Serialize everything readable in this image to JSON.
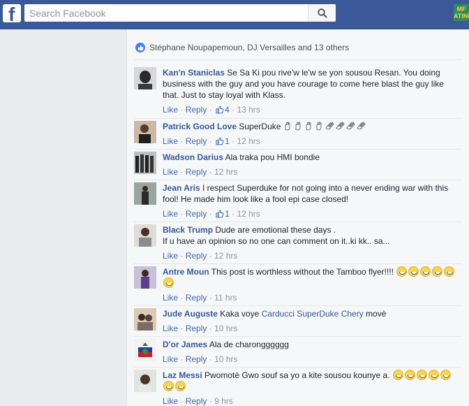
{
  "search": {
    "placeholder": "Search Facebook"
  },
  "app_badge": "MF ATINF",
  "reactions": {
    "text": "Stéphane Noupapemoun, DJ Versailles and 13 others"
  },
  "actions": {
    "like": "Like",
    "reply": "Reply",
    "dot": "·"
  },
  "comments": [
    {
      "author": "Kan'n Staniclas",
      "text": "Se Sa Ki pou rive'w le'w se yon sousou Resan. You doing business with the guy and you have courage to come here blast the guy like that. Just to stay loyal with Klass.",
      "likes": "4",
      "time": "13 hrs"
    },
    {
      "author": "Patrick Good Love",
      "text": "SuperDuke",
      "likes": "1",
      "time": "12 hrs"
    },
    {
      "author": "Wadson Darius",
      "text": "Ala traka pou HMI bondie",
      "likes": "",
      "time": "12 hrs"
    },
    {
      "author": "Jean Aris",
      "text": "I respect Superduke for not going into a never ending war with this fool! He made him look like a fool epi case closed!",
      "likes": "1",
      "time": "12 hrs"
    },
    {
      "author": "Black Trump",
      "text": "Dude are emotional these days .",
      "text2": "If u have an opinion so no one can comment on it..ki kk.. sa...",
      "likes": "",
      "time": "12 hrs"
    },
    {
      "author": "Antre Moun",
      "text": "This post is worthless without the Tamboo flyer!!!!",
      "likes": "",
      "time": "11 hrs"
    },
    {
      "author": "Jude Auguste",
      "text": "Kaka voye",
      "mention": "Carducci SuperDuke Chery",
      "text_after": "movè",
      "likes": "",
      "time": "10 hrs"
    },
    {
      "author": "D'or James",
      "text": "Ala de charongggggg",
      "likes": "",
      "time": "10 hrs"
    },
    {
      "author": "Laz Messi",
      "text": "Pwomotè Gwo souf sa yo a kite sousou kounye a.",
      "likes": "",
      "time": "9 hrs"
    }
  ],
  "colors": {
    "bar": "#3b5998",
    "link": "#365899",
    "muted": "#90949c",
    "bg": "#f6f7f9"
  }
}
